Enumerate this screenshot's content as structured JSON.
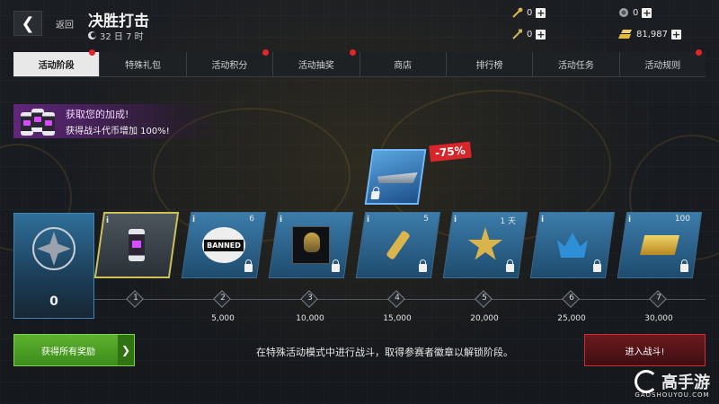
{
  "header": {
    "back_label": "返回",
    "title": "决胜打击",
    "timer": "32 日 7 时"
  },
  "currencies": [
    {
      "name": "match-key",
      "value": "0"
    },
    {
      "name": "silver-token",
      "value": "0"
    },
    {
      "name": "boost-key",
      "value": "0"
    },
    {
      "name": "gold",
      "value": "81,987"
    }
  ],
  "tabs": [
    {
      "label": "活动阶段",
      "active": true,
      "dot": true
    },
    {
      "label": "特殊礼包",
      "active": false,
      "dot": false
    },
    {
      "label": "活动积分",
      "active": false,
      "dot": true
    },
    {
      "label": "活动抽奖",
      "active": false,
      "dot": true
    },
    {
      "label": "商店",
      "active": false,
      "dot": false
    },
    {
      "label": "排行榜",
      "active": false,
      "dot": false
    },
    {
      "label": "活动任务",
      "active": false,
      "dot": false
    },
    {
      "label": "活动规则",
      "active": false,
      "dot": true
    }
  ],
  "bonus": {
    "title": "获取您的加成!",
    "desc": "获得战斗代币增加 100%!"
  },
  "featured": {
    "discount": "-75%"
  },
  "level": {
    "value": "0"
  },
  "rewards": [
    {
      "icon": "token-can-icon",
      "info": "i",
      "count": ""
    },
    {
      "icon": "banned-badge-icon",
      "info": "i",
      "count": "6"
    },
    {
      "icon": "commander-portrait-icon",
      "info": "i",
      "count": ""
    },
    {
      "icon": "key-icon",
      "info": "i",
      "count": "5"
    },
    {
      "icon": "star-badge-icon",
      "info": "i",
      "count": "1 天"
    },
    {
      "icon": "crown-icon",
      "info": "i",
      "count": ""
    },
    {
      "icon": "gold-bar-icon",
      "info": "i",
      "count": "100"
    }
  ],
  "stages": [
    {
      "num": "1",
      "threshold": ""
    },
    {
      "num": "2",
      "threshold": "5,000"
    },
    {
      "num": "3",
      "threshold": "10,000"
    },
    {
      "num": "4",
      "threshold": "15,000"
    },
    {
      "num": "5",
      "threshold": "20,000"
    },
    {
      "num": "6",
      "threshold": "25,000"
    },
    {
      "num": "7",
      "threshold": "30,000"
    }
  ],
  "footer": {
    "claim_all": "获得所有奖励",
    "hint": "在特殊活动模式中进行战斗，取得参赛者徽章以解锁阶段。",
    "battle": "进入战斗!"
  },
  "watermark": {
    "brand": "高手游",
    "domain": "GAOSHOUYOU.COM"
  },
  "colors": {
    "accent_green": "#5bb12d",
    "accent_red": "#d12a30",
    "card_blue": "#3c7cab",
    "active_tab": "#e8e8e8"
  }
}
